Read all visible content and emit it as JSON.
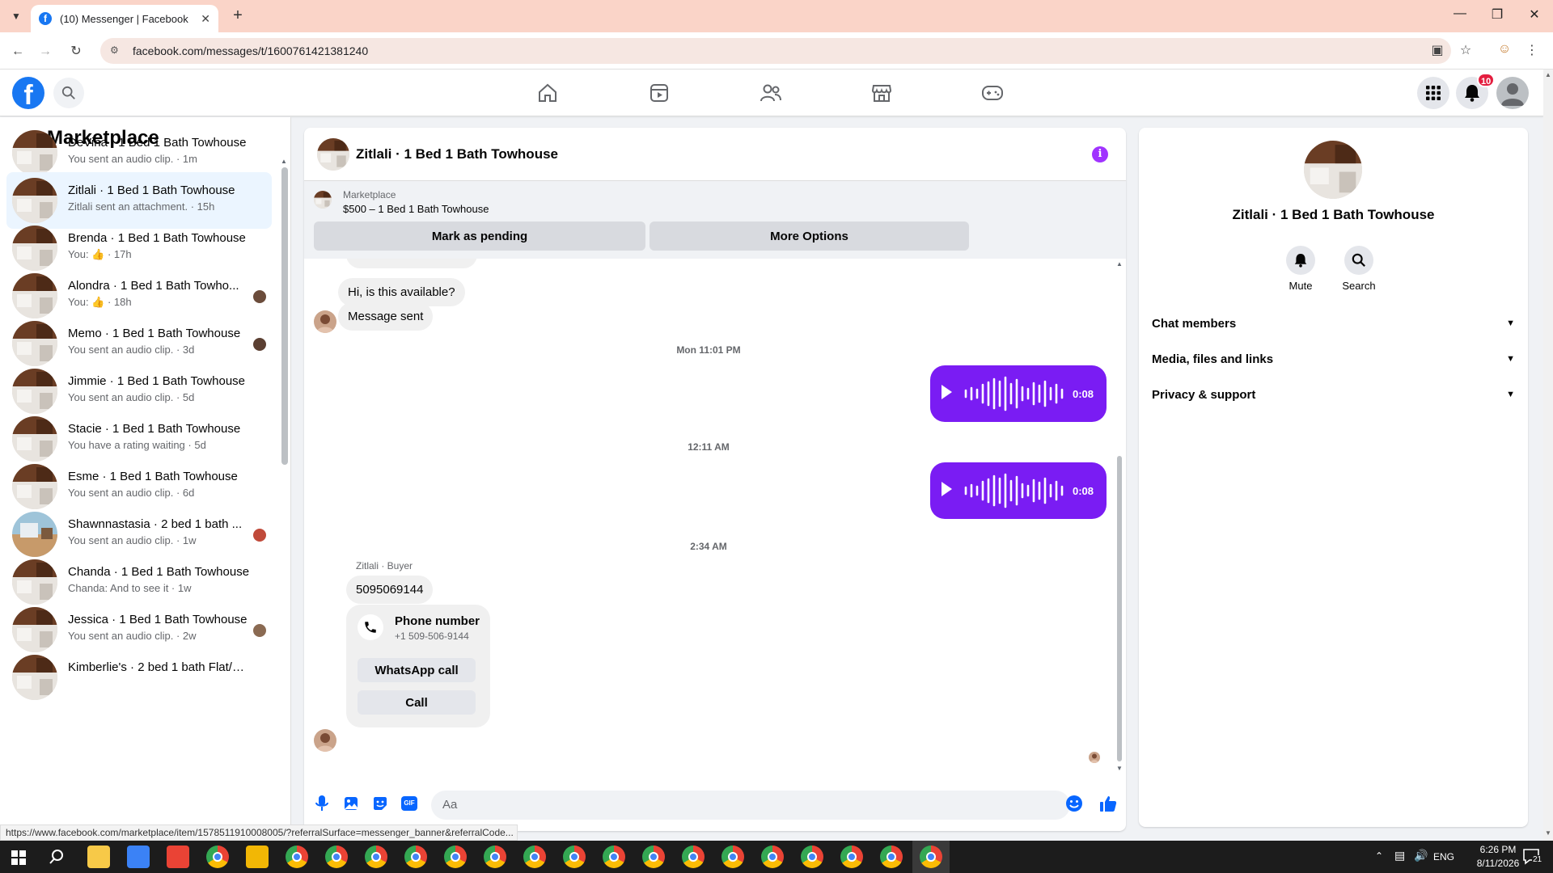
{
  "browser": {
    "tab_title": "(10) Messenger | Facebook",
    "url": "facebook.com/messages/t/1600761421381240",
    "status_link": "https://www.facebook.com/marketplace/item/1578511910008005/?referralSurface=messenger_banner&referralCode..."
  },
  "header": {
    "notification_count": "10"
  },
  "left_panel": {
    "title": "Marketplace",
    "conversations": [
      {
        "name": "DeVina · 1 Bed 1 Bath Towhouse",
        "preview": "You sent an audio clip. · 1m"
      },
      {
        "name": "Zitlali · 1 Bed 1 Bath Towhouse",
        "preview": "Zitlali sent an attachment. · 15h"
      },
      {
        "name": "Brenda · 1 Bed 1 Bath Towhouse",
        "preview": "You: 👍 · 17h"
      },
      {
        "name": "Alondra · 1 Bed 1 Bath Towho...",
        "preview": "You: 👍 · 18h"
      },
      {
        "name": "Memo · 1 Bed 1 Bath Towhouse",
        "preview": "You sent an audio clip. · 3d"
      },
      {
        "name": "Jimmie · 1 Bed 1 Bath Towhouse",
        "preview": "You sent an audio clip. · 5d"
      },
      {
        "name": "Stacie · 1 Bed 1 Bath Towhouse",
        "preview": "You have a rating waiting · 5d"
      },
      {
        "name": "Esme · 1 Bed 1 Bath Towhouse",
        "preview": "You sent an audio clip. · 6d"
      },
      {
        "name": "Shawnnastasia · 2 bed 1 bath ...",
        "preview": "You sent an audio clip. · 1w"
      },
      {
        "name": "Chanda · 1 Bed 1 Bath Towhouse",
        "preview": "Chanda: And to see it · 1w"
      },
      {
        "name": "Jessica · 1 Bed 1 Bath Towhouse",
        "preview": "You sent an audio clip. · 2w"
      },
      {
        "name": "Kimberlie's · 2 bed 1 bath Flat/ap...",
        "preview": ""
      }
    ]
  },
  "chat": {
    "title": "Zitlali · 1 Bed 1 Bath Towhouse",
    "banner": {
      "label": "Marketplace",
      "listing": "$500 – 1 Bed 1 Bath Towhouse",
      "mark_pending": "Mark as pending",
      "more_options": "More Options"
    },
    "messages": {
      "msg1": "Hi, is this available?",
      "msg2": "Message sent",
      "ts1": "Mon 11:01 PM",
      "audio1_duration": "0:08",
      "ts2": "12:11 AM",
      "audio2_duration": "0:08",
      "ts3": "2:34 AM",
      "sender_label": "Zitlali · Buyer",
      "phone_msg": "5095069144",
      "phone_card_title": "Phone number",
      "phone_card_number": "+1 509-506-9144",
      "whatsapp_label": "WhatsApp call",
      "call_label": "Call"
    },
    "composer_placeholder": "Aa"
  },
  "right_panel": {
    "name": "Zitlali · 1 Bed 1 Bath Towhouse",
    "mute_label": "Mute",
    "search_label": "Search",
    "sections": [
      "Chat members",
      "Media, files and links",
      "Privacy & support"
    ]
  },
  "taskbar": {
    "time": "6:26 PM",
    "date": "8/11/2026",
    "lang": "ENG",
    "notif_count": "21"
  },
  "colors": {
    "fb_blue": "#1877f2",
    "audio_purple": "#7a1cf3",
    "badge_red": "#e41e3f",
    "tab_strip": "#fad4c8"
  }
}
